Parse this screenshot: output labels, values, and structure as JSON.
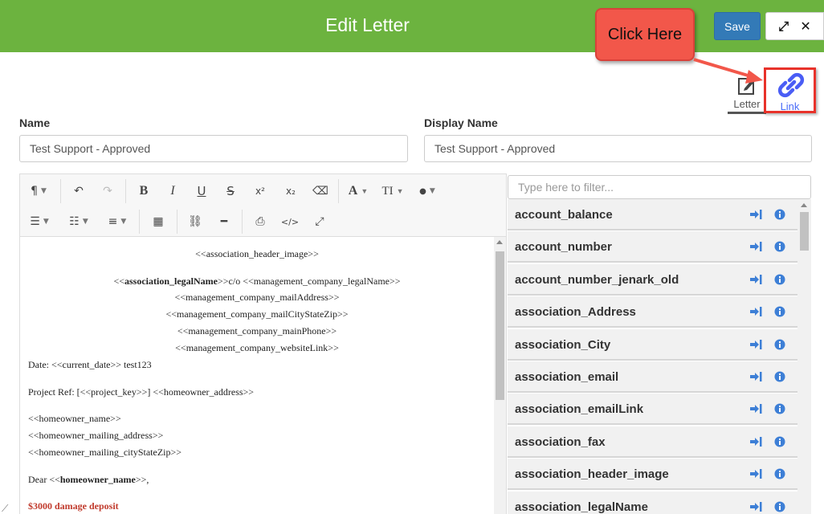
{
  "header": {
    "title": "Edit Letter",
    "save_label": "Save",
    "expand_glyph": "⤢",
    "close_glyph": "✕",
    "color": "#6cb33f"
  },
  "callout": {
    "text": "Click Here",
    "color": "#f2574a"
  },
  "tabs": [
    {
      "label": "Letter",
      "icon": "edit-icon"
    },
    {
      "label": "Link",
      "icon": "link-icon",
      "highlight": "#e8322a"
    }
  ],
  "form": {
    "name_label": "Name",
    "name_value": "Test Support - Approved",
    "display_name_label": "Display Name",
    "display_name_value": "Test Support - Approved"
  },
  "editor": {
    "toolbar_row1": [
      {
        "icon": "paragraph-icon",
        "glyph": "¶"
      },
      {
        "icon": "undo-icon",
        "glyph": "↶"
      },
      {
        "icon": "redo-icon",
        "glyph": "↷"
      },
      {
        "icon": "bold-icon",
        "glyph": "B"
      },
      {
        "icon": "italic-icon",
        "glyph": "I"
      },
      {
        "icon": "underline-icon",
        "glyph": "U"
      },
      {
        "icon": "strikethrough-icon",
        "glyph": "S"
      },
      {
        "icon": "superscript-icon",
        "glyph": "x²"
      },
      {
        "icon": "subscript-icon",
        "glyph": "x₂"
      },
      {
        "icon": "eraser-icon",
        "glyph": "⌫"
      },
      {
        "icon": "font-icon",
        "glyph": "A"
      },
      {
        "icon": "text-size-icon",
        "glyph": "TI"
      },
      {
        "icon": "color-drop-icon",
        "glyph": "●"
      }
    ],
    "toolbar_row2": [
      {
        "icon": "bullet-list-icon",
        "glyph": "☰"
      },
      {
        "icon": "numbered-list-icon",
        "glyph": "☷"
      },
      {
        "icon": "align-icon",
        "glyph": "≡"
      },
      {
        "icon": "table-icon",
        "glyph": "▦"
      },
      {
        "icon": "link-icon",
        "glyph": "⛓"
      },
      {
        "icon": "horizontal-rule-icon",
        "glyph": "━"
      },
      {
        "icon": "print-icon",
        "glyph": "⎙"
      },
      {
        "icon": "code-view-icon",
        "glyph": "</>"
      },
      {
        "icon": "fullscreen-icon",
        "glyph": "⤢"
      }
    ],
    "content": {
      "header_image": "<<association_header_image>>",
      "legal_name_prefix": "<<",
      "legal_name_bold": "association_legalName",
      "legal_name_suffix": ">>c/o <<management_company_legalName>>",
      "mail_address": "<<management_company_mailAddress>>",
      "mail_city": "<<management_company_mailCityStateZip>>",
      "main_phone": "<<management_company_mainPhone>>",
      "website_link": "<<management_company_websiteLink>>",
      "date_line": "Date: <<current_date>> test123",
      "project_line": "Project Ref: [<<project_key>>] <<homeowner_address>>",
      "homeowner_name": "<<homeowner_name>>",
      "homeowner_mailing": "<<homeowner_mailing_address>>",
      "homeowner_city": "<<homeowner_mailing_cityStateZip>>",
      "dear_prefix": "Dear <<",
      "dear_bold": "homeowner_name",
      "dear_suffix": ">>,",
      "deposit": "$3000 damage deposit"
    }
  },
  "variables": {
    "filter_placeholder": "Type here to filter...",
    "items": [
      "account_balance",
      "account_number",
      "account_number_jenark_old",
      "association_Address",
      "association_City",
      "association_email",
      "association_emailLink",
      "association_fax",
      "association_header_image",
      "association_legalName"
    ]
  }
}
